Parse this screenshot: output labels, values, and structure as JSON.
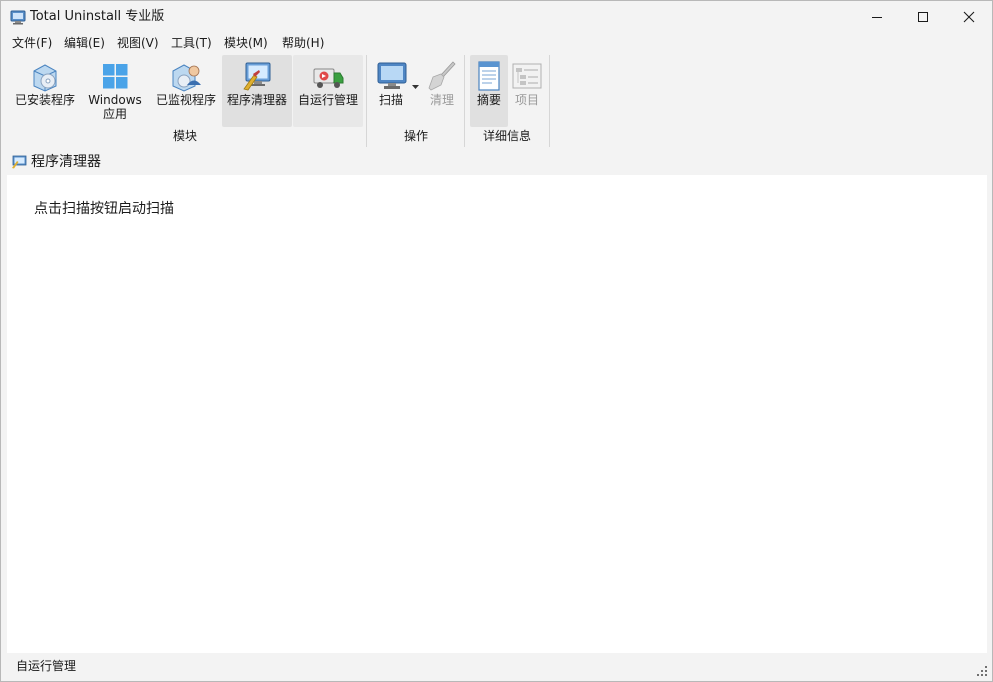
{
  "window": {
    "title": "Total Uninstall 专业版",
    "controls": [
      "minimize",
      "maximize",
      "close"
    ]
  },
  "menu": {
    "items": [
      "文件(F)",
      "编辑(E)",
      "视图(V)",
      "工具(T)",
      "模块(M)",
      "帮助(H)"
    ]
  },
  "ribbon": {
    "groups": [
      {
        "label": "模块",
        "buttons": [
          {
            "label": "已安装程序",
            "icon": "installed-programs-icon",
            "state": "normal"
          },
          {
            "label": "Windows\n应用",
            "icon": "windows-apps-icon",
            "state": "normal"
          },
          {
            "label": "已监视程序",
            "icon": "monitored-programs-icon",
            "state": "normal"
          },
          {
            "label": "程序清理器",
            "icon": "program-cleaner-icon",
            "state": "selected"
          },
          {
            "label": "自运行管理",
            "icon": "autorun-manager-icon",
            "state": "highlighted"
          }
        ]
      },
      {
        "label": "操作",
        "buttons": [
          {
            "label": "扫描",
            "icon": "scan-icon",
            "state": "normal",
            "dropdown": true
          },
          {
            "label": "清理",
            "icon": "clean-broom-icon",
            "state": "disabled"
          }
        ]
      },
      {
        "label": "详细信息",
        "buttons": [
          {
            "label": "摘要",
            "icon": "summary-icon",
            "state": "selected"
          },
          {
            "label": "项目",
            "icon": "items-icon",
            "state": "disabled"
          }
        ]
      }
    ]
  },
  "panel": {
    "title": "程序清理器",
    "icon": "program-cleaner-small-icon",
    "hint": "点击扫描按钮启动扫描"
  },
  "status": {
    "text": "自运行管理"
  },
  "colors": {
    "window_bg": "#f3f3f3",
    "content_bg": "#ffffff",
    "selected_button_bg": "#e0e0e0",
    "disabled_text": "#9a9a9a"
  }
}
